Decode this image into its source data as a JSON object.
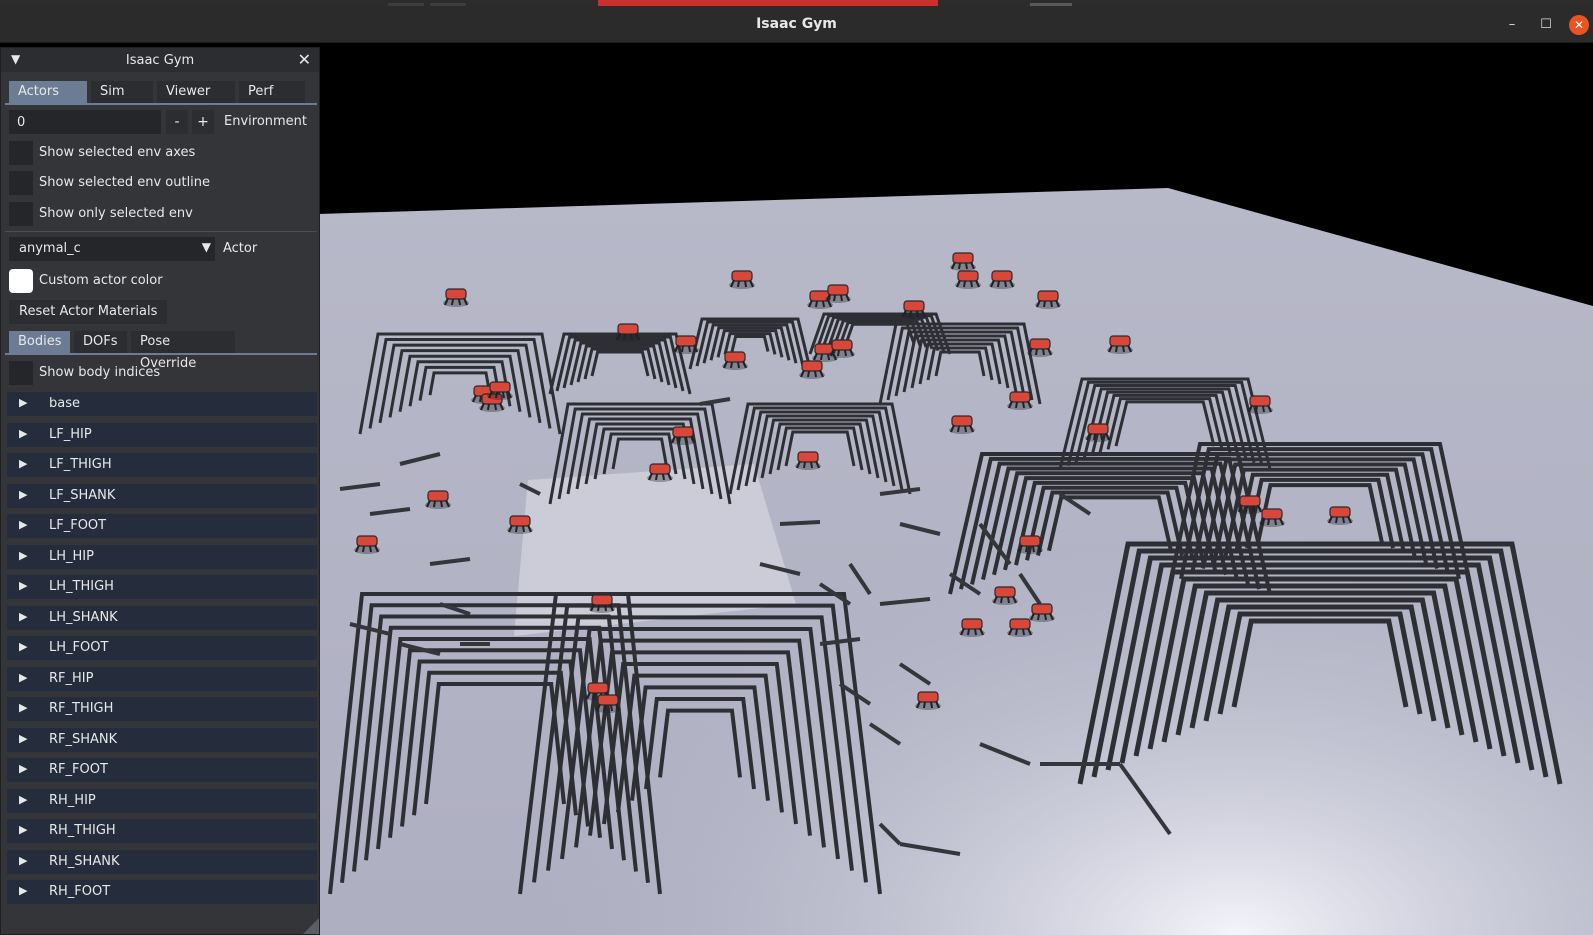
{
  "window": {
    "title": "Isaac Gym",
    "minimize_glyph": "–",
    "maximize_glyph": "☐",
    "close_glyph": "✕"
  },
  "panel": {
    "title": "Isaac Gym",
    "collapse_glyph": "▼",
    "close_glyph": "✕",
    "tabs": [
      {
        "label": "Actors",
        "active": true
      },
      {
        "label": "Sim",
        "active": false
      },
      {
        "label": "Viewer",
        "active": false
      },
      {
        "label": "Perf",
        "active": false
      }
    ],
    "environment": {
      "value": "0",
      "minus": "-",
      "plus": "+",
      "label": "Environment"
    },
    "env_checks": [
      {
        "label": "Show selected env axes",
        "checked": false
      },
      {
        "label": "Show selected env outline",
        "checked": false
      },
      {
        "label": "Show only selected env",
        "checked": false
      }
    ],
    "actor": {
      "selected": "anymal_c",
      "arrow": "▼",
      "label": "Actor"
    },
    "custom_color_label": "Custom actor color",
    "reset_label": "Reset Actor Materials",
    "subtabs": [
      {
        "label": "Bodies",
        "active": true
      },
      {
        "label": "DOFs",
        "active": false
      },
      {
        "label": "Pose Override",
        "active": false
      }
    ],
    "show_body_indices_label": "Show body indices",
    "tree_glyph": "▶",
    "bodies": [
      "base",
      "LF_HIP",
      "LF_THIGH",
      "LF_SHANK",
      "LF_FOOT",
      "LH_HIP",
      "LH_THIGH",
      "LH_SHANK",
      "LH_FOOT",
      "RF_HIP",
      "RF_THIGH",
      "RF_SHANK",
      "RF_FOOT",
      "RH_HIP",
      "RH_THIGH",
      "RH_SHANK",
      "RH_FOOT"
    ]
  },
  "colors": {
    "accent": "#6c7c94",
    "panel_bg": "#333539",
    "titlebar_bg": "#2b2b2b",
    "terrain": "#b4b5c6",
    "stair_dark": "#2e2f35",
    "robot_red": "#d9473b",
    "close_button": "#e95420"
  }
}
